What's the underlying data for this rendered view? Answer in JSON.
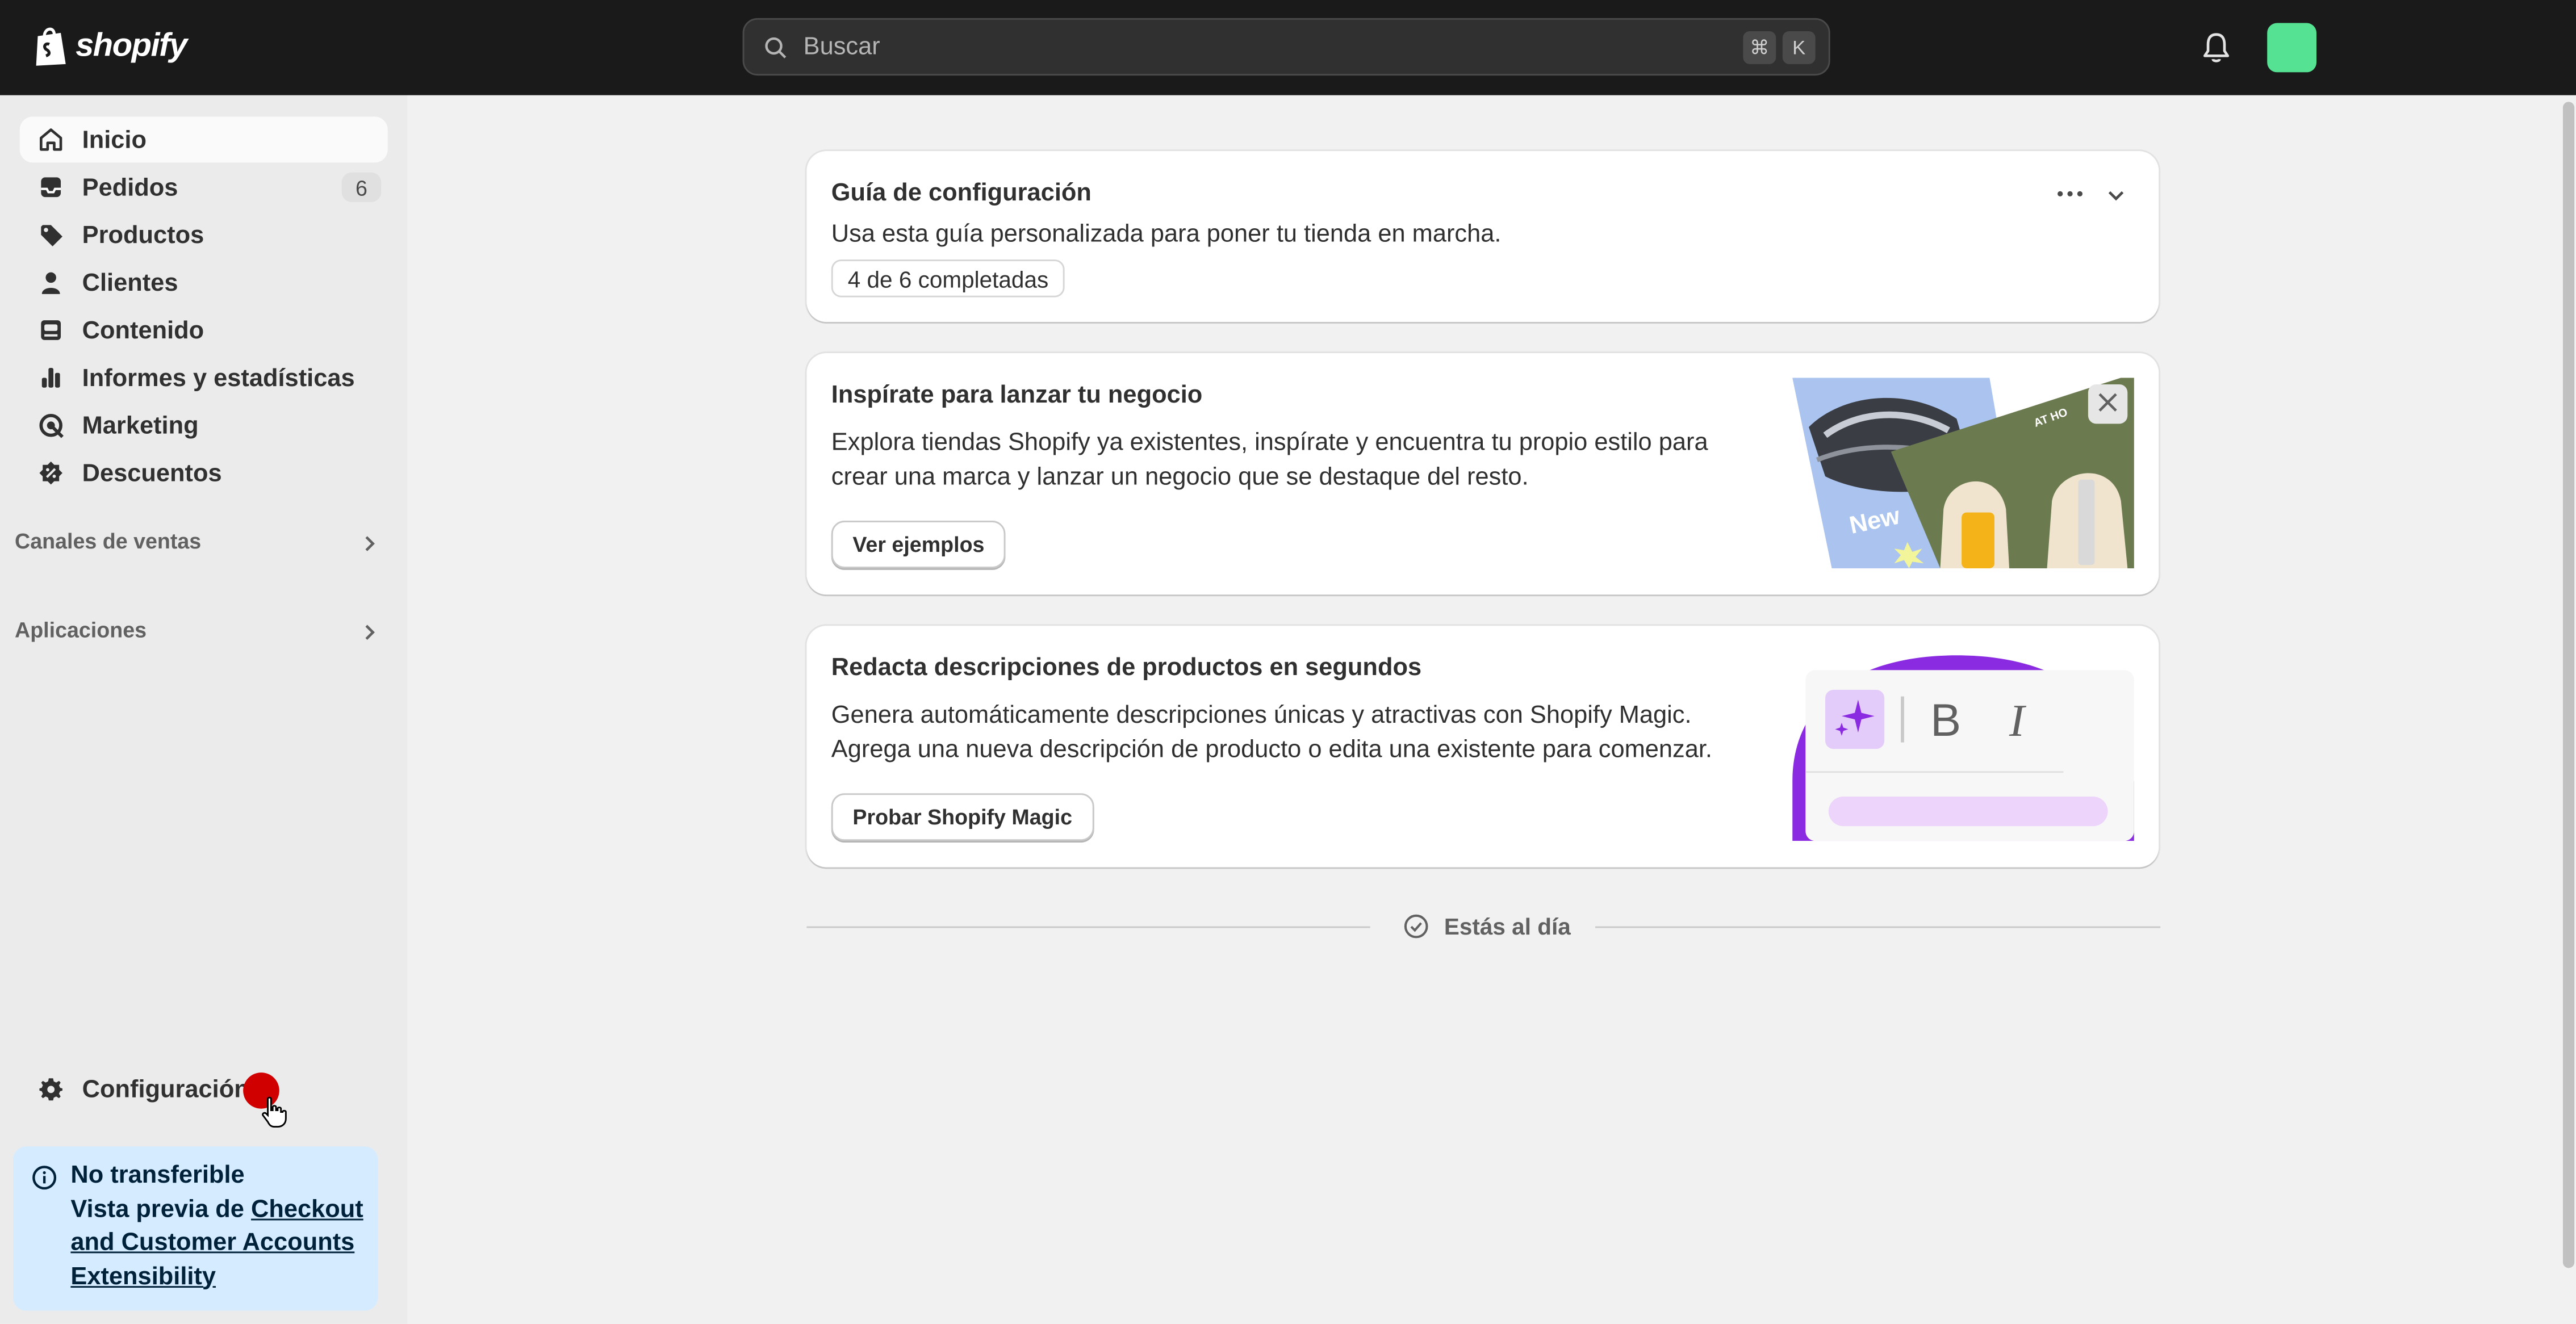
{
  "topbar": {
    "brand": "shopify",
    "search_placeholder": "Buscar",
    "shortcut_cmd": "⌘",
    "shortcut_key": "K"
  },
  "sidebar": {
    "items": [
      {
        "label": "Inicio",
        "icon": "home-icon"
      },
      {
        "label": "Pedidos",
        "icon": "inbox-icon",
        "badge": "6"
      },
      {
        "label": "Productos",
        "icon": "tag-icon"
      },
      {
        "label": "Clientes",
        "icon": "person-icon"
      },
      {
        "label": "Contenido",
        "icon": "content-icon"
      },
      {
        "label": "Informes y estadísticas",
        "icon": "bar-chart-icon"
      },
      {
        "label": "Marketing",
        "icon": "target-icon"
      },
      {
        "label": "Descuentos",
        "icon": "discount-icon"
      }
    ],
    "sections": [
      {
        "label": "Canales de ventas"
      },
      {
        "label": "Aplicaciones"
      }
    ],
    "settings_label": "Configuración",
    "notice": {
      "title": "No transferible",
      "text_prefix": "Vista previa de ",
      "link": "Checkout and Customer Accounts Extensibility"
    }
  },
  "main": {
    "setup_guide": {
      "title": "Guía de configuración",
      "description": "Usa esta guía personalizada para poner tu tienda en marcha.",
      "progress": "4 de 6 completadas"
    },
    "inspire_card": {
      "title": "Inspírate para lanzar tu negocio",
      "description": "Explora tiendas Shopify ya existentes, inspírate y encuentra tu propio estilo para crear una marca y lanzar un negocio que se destaque del resto.",
      "button": "Ver ejemplos",
      "image_tag_new": "New",
      "image_tag_at": "AT HO"
    },
    "magic_card": {
      "title": "Redacta descripciones de productos en segundos",
      "description": "Genera automáticamente descripciones únicas y atractivas con Shopify Magic. Agrega una nueva descripción de producto o edita una existente para comenzar.",
      "button": "Probar Shopify Magic",
      "bold_glyph": "B",
      "italic_glyph": "I"
    },
    "footer_status": "Estás al día"
  },
  "colors": {
    "topbar": "#1a1a1a",
    "avatar": "#56e293",
    "notification_dot": "#d10000",
    "notice_bg": "#d5ebff",
    "magic_purple": "#8a2be2"
  }
}
